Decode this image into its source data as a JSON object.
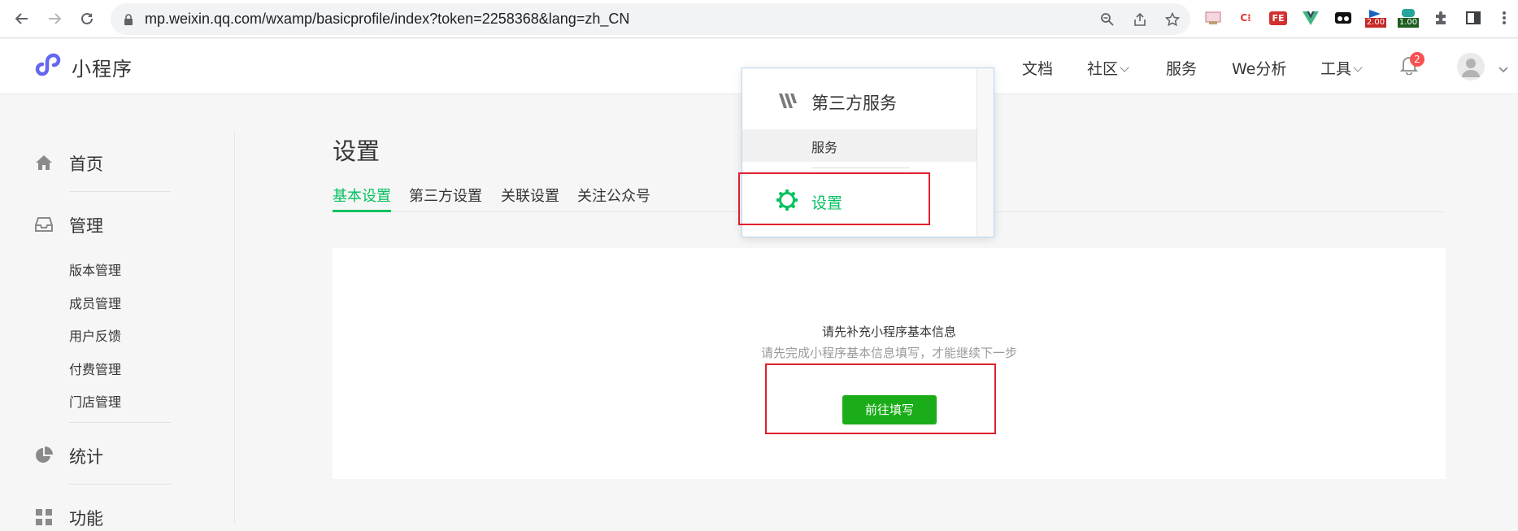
{
  "browser": {
    "url": "mp.weixin.qq.com/wxamp/basicprofile/index?token=2258368&lang=zh_CN",
    "extensions": [
      {
        "icon": "bookmark-ext-icon",
        "label": ""
      },
      {
        "icon": "c-ext-icon",
        "label": "C⁝"
      },
      {
        "icon": "fe-ext-icon",
        "label": "FE"
      },
      {
        "icon": "vue-devtools-icon",
        "label": ""
      },
      {
        "icon": "glasses-ext-icon",
        "label": ""
      },
      {
        "icon": "speed-ext-icon",
        "badge": "2.00"
      },
      {
        "icon": "speed2-ext-icon",
        "badge": "1.00"
      },
      {
        "icon": "puzzle-icon",
        "label": ""
      },
      {
        "icon": "sidepanel-icon",
        "label": ""
      },
      {
        "icon": "more-vert-icon",
        "label": ""
      }
    ]
  },
  "header": {
    "app_name": "小程序",
    "nav": {
      "docs": "文档",
      "community": "社区",
      "service": "服务",
      "analytics": "We分析",
      "tools": "工具"
    },
    "notification_count": "2"
  },
  "sidebar": {
    "home": "首页",
    "manage": "管理",
    "manage_items": [
      "版本管理",
      "成员管理",
      "用户反馈",
      "付费管理",
      "门店管理"
    ],
    "stats": "统计",
    "features": "功能"
  },
  "main": {
    "title": "设置",
    "tabs": [
      "基本设置",
      "第三方设置",
      "关联设置",
      "关注公众号"
    ],
    "prompt_title": "请先补充小程序基本信息",
    "prompt_desc": "请先完成小程序基本信息填写，才能继续下一步",
    "fill_button": "前往填写"
  },
  "popup": {
    "header": "第三方服务",
    "service_item": "服务",
    "settings_item": "设置"
  },
  "colors": {
    "accent_green": "#07c160",
    "button_green": "#1aad19",
    "highlight_red": "#e0202c",
    "badge_red": "#fa5151"
  }
}
